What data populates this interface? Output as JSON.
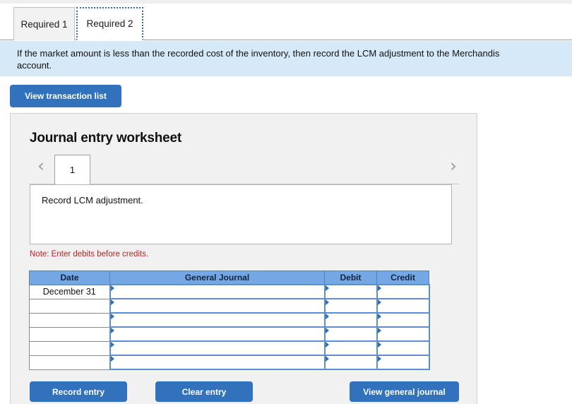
{
  "tabs": [
    {
      "label": "Required 1",
      "active": false
    },
    {
      "label": "Required 2",
      "active": true
    }
  ],
  "banner": {
    "line1": "If the market amount is less than the recorded cost of the inventory, then record the LCM adjustment to the Merchandis",
    "line2": "account."
  },
  "toolbar": {
    "view_transaction_list": "View transaction list"
  },
  "worksheet": {
    "title": "Journal entry worksheet",
    "prev_icon": "chevron-left-icon",
    "next_icon": "chevron-right-icon",
    "page_tab": "1",
    "description": "Record LCM adjustment.",
    "note": "Note: Enter debits before credits."
  },
  "journal_table": {
    "headers": [
      "Date",
      "General Journal",
      "Debit",
      "Credit"
    ],
    "rows": [
      {
        "date": "December 31",
        "general_journal": "",
        "debit": "",
        "credit": ""
      },
      {
        "date": "",
        "general_journal": "",
        "debit": "",
        "credit": ""
      },
      {
        "date": "",
        "general_journal": "",
        "debit": "",
        "credit": ""
      },
      {
        "date": "",
        "general_journal": "",
        "debit": "",
        "credit": ""
      },
      {
        "date": "",
        "general_journal": "",
        "debit": "",
        "credit": ""
      },
      {
        "date": "",
        "general_journal": "",
        "debit": "",
        "credit": ""
      }
    ]
  },
  "actions": {
    "record_entry": "Record entry",
    "clear_entry": "Clear entry",
    "view_general_journal": "View general journal"
  },
  "colors": {
    "button_blue": "#3272bd",
    "banner_blue": "#d6e9f8",
    "table_header_blue": "#74a7e3",
    "note_red": "#c0221f",
    "panel_grey": "#f1f1f1"
  }
}
